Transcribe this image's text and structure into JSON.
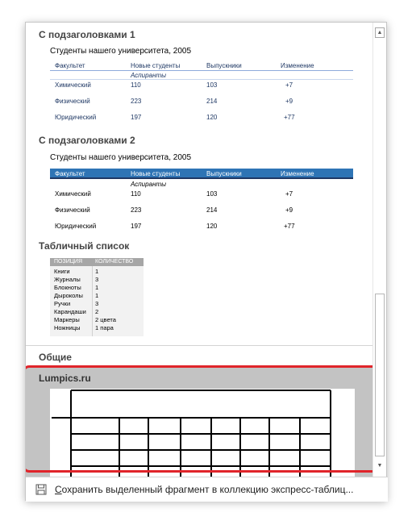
{
  "gallery": {
    "sections": [
      {
        "heading": "С подзаголовками 1",
        "table_title": "Студенты нашего университета, 2005",
        "columns": [
          "Факультет",
          "Новые студенты",
          "Выпускники",
          "Изменение"
        ],
        "subheading": "Аспиранты",
        "rows": [
          [
            "Химический",
            "110",
            "103",
            "+7"
          ],
          [
            "Физический",
            "223",
            "214",
            "+9"
          ],
          [
            "Юридический",
            "197",
            "120",
            "+77"
          ]
        ]
      },
      {
        "heading": "С подзаголовками 2",
        "table_title": "Студенты нашего университета, 2005",
        "columns": [
          "Факультет",
          "Новые студенты",
          "Выпускники",
          "Изменение"
        ],
        "subheading": "Аспиранты",
        "rows": [
          [
            "Химический",
            "110",
            "103",
            "+7"
          ],
          [
            "Физический",
            "223",
            "214",
            "+9"
          ],
          [
            "Юридический",
            "197",
            "120",
            "+77"
          ]
        ]
      },
      {
        "heading": "Табличный список",
        "columns": [
          "ПОЗИЦИЯ",
          "КОЛИЧЕСТВО"
        ],
        "rows": [
          [
            "Книги",
            "1"
          ],
          [
            "Журналы",
            "3"
          ],
          [
            "Блокноты",
            "1"
          ],
          [
            "Дыроколы",
            "1"
          ],
          [
            "Ручки",
            "3"
          ],
          [
            "Карандаши",
            "2"
          ],
          [
            "Маркеры",
            "2 цвета"
          ],
          [
            "Ножницы",
            "1 пара"
          ]
        ]
      }
    ],
    "general_heading": "Общие",
    "selected_item": {
      "label": "Lumpics.ru"
    }
  },
  "footer": {
    "save_label_accel": "С",
    "save_label_rest": "охранить выделенный фрагмент в коллекцию экспресс-таблиц..."
  },
  "colors": {
    "accent_blue": "#2e74b5",
    "header_dark": "#1f3864",
    "selection_bg": "#c3c3c3",
    "highlight_red": "#e0242a"
  }
}
